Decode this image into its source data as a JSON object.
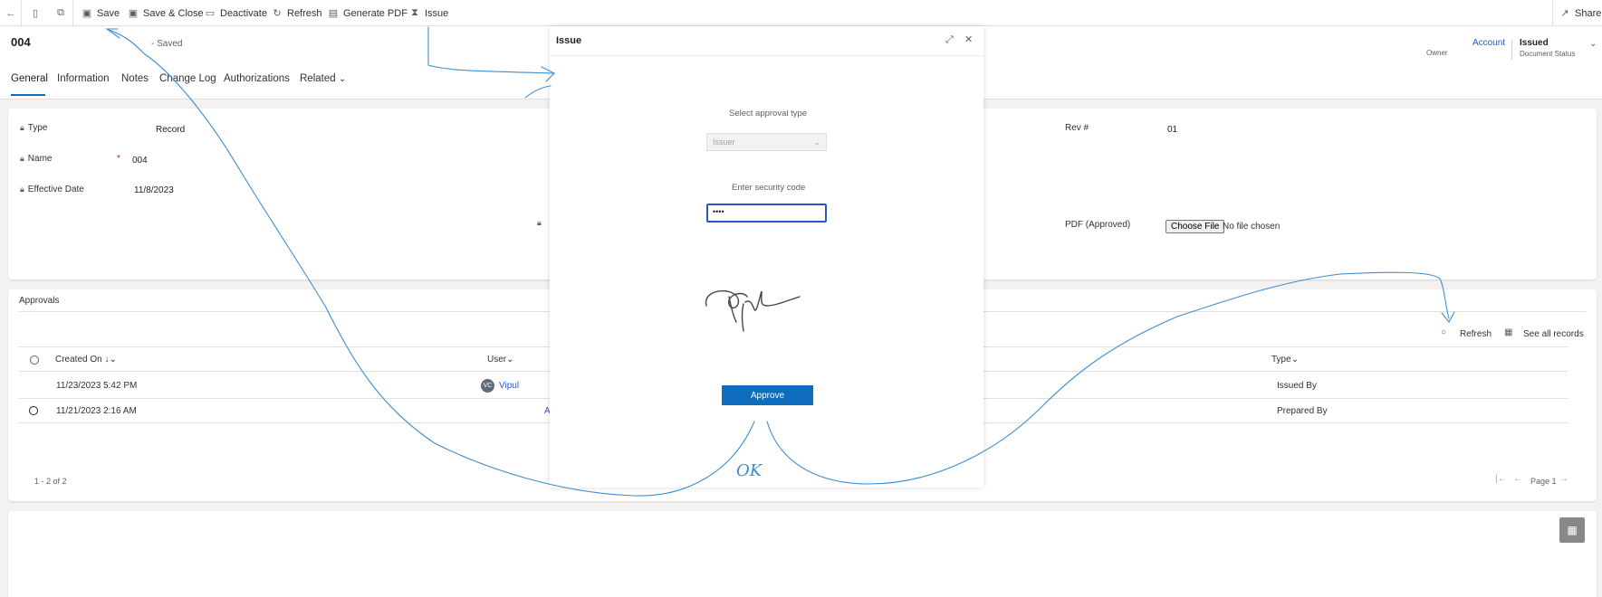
{
  "toolbar": {
    "save": "Save",
    "save_close": "Save & Close",
    "deactivate": "Deactivate",
    "refresh": "Refresh",
    "generate_pdf": "Generate PDF",
    "issue": "Issue",
    "share": "Share"
  },
  "header": {
    "title": "004",
    "saved": "- Saved",
    "owner_label": "Owner",
    "account": "Account",
    "status_value": "Issued",
    "status_label": "Document Status"
  },
  "tabs": [
    "General",
    "Information",
    "Notes",
    "Change Log",
    "Authorizations",
    "Related"
  ],
  "form": {
    "type_label": "Type",
    "type_value": "Record",
    "name_label": "Name",
    "required_mark": "*",
    "name_value": "004",
    "effective_label": "Effective Date",
    "effective_value": "11/8/2023",
    "rev_label": "Rev #",
    "rev_value": "01",
    "pdf_label": "PDF (Approved)",
    "choose_file": "Choose File",
    "no_file": "No file chosen"
  },
  "approvals": {
    "title": "Approvals",
    "refresh": "Refresh",
    "see_all": "See all records",
    "col_created": "Created On",
    "col_user": "User",
    "col_type": "Type",
    "rows": [
      {
        "created": "11/23/2023 5:42 PM",
        "avatar": "VC",
        "user": "Vipul",
        "type": "Issued By"
      },
      {
        "created": "11/21/2023 2:16 AM",
        "user": "A",
        "type": "Prepared By"
      }
    ],
    "count": "1 - 2 of 2",
    "page": "Page 1"
  },
  "modal": {
    "title": "Issue",
    "approval_type_label": "Select approval type",
    "approval_type_value": "Issuer",
    "security_label": "Enter security code",
    "security_value": "••••",
    "approve": "Approve"
  },
  "annotation": {
    "ok_text": "OK"
  }
}
